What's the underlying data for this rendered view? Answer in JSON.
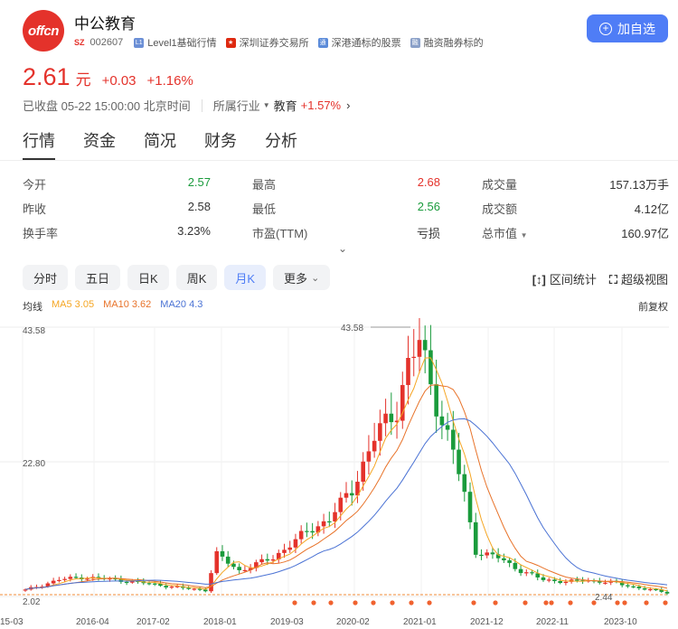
{
  "header": {
    "logo_text": "offcn",
    "stock_name": "中公教育",
    "market_tag": "SZ",
    "code": "002607",
    "badges": [
      {
        "icon": "level1-badge-icon",
        "label": "Level1基础行情"
      },
      {
        "icon": "china-flag-icon",
        "label": "深圳证券交易所"
      },
      {
        "icon": "shenzhen-hk-connect-icon",
        "label": "深港通标的股票"
      },
      {
        "icon": "margin-trading-icon",
        "label": "融资融券标的"
      }
    ],
    "add_button": "加自选"
  },
  "quote": {
    "price": "2.61",
    "unit": "元",
    "change": "+0.03",
    "change_pct": "+1.16%",
    "status": "已收盘 05-22 15:00:00 北京时间",
    "industry_label": "所属行业",
    "industry": "教育",
    "industry_change": "+1.57%"
  },
  "tabs": [
    "行情",
    "资金",
    "简况",
    "财务",
    "分析"
  ],
  "stats": [
    [
      {
        "label": "今开",
        "value": "2.57",
        "color": "green"
      },
      {
        "label": "最高",
        "value": "2.68",
        "color": "red"
      },
      {
        "label": "成交量",
        "value": "157.13万手",
        "color": "dark"
      }
    ],
    [
      {
        "label": "昨收",
        "value": "2.58",
        "color": "dark"
      },
      {
        "label": "最低",
        "value": "2.56",
        "color": "green"
      },
      {
        "label": "成交额",
        "value": "4.12亿",
        "color": "dark"
      }
    ],
    [
      {
        "label": "换手率",
        "value": "3.23%",
        "color": "dark"
      },
      {
        "label": "市盈(TTM)",
        "value": "亏损",
        "color": "dark"
      },
      {
        "label": "总市值",
        "value": "160.97亿",
        "color": "dark"
      }
    ]
  ],
  "kline_buttons": [
    "分时",
    "五日",
    "日K",
    "周K",
    "月K",
    "更多"
  ],
  "kline_active": "月K",
  "tools": {
    "range_stats": "区间统计",
    "super_view": "超级视图"
  },
  "ma": {
    "label": "均线",
    "ma5": "MA5 3.05",
    "ma10": "MA10 3.62",
    "ma20": "MA20 4.3"
  },
  "adjust": "前复权",
  "colors": {
    "up": "#e4322b",
    "down": "#1a9b3c",
    "ma5": "#f5a623",
    "ma10": "#e8732a",
    "ma20": "#4a72d4",
    "accent": "#4f7df6"
  },
  "chart_data": {
    "type": "candlestick",
    "y_labels": [
      "43.58",
      "22.80",
      "2.02"
    ],
    "x_labels": [
      "15-03",
      "2016-04",
      "2017-02",
      "2018-01",
      "2019-03",
      "2020-02",
      "2021-01",
      "2021-12",
      "2022-11",
      "2023-10"
    ],
    "ylim": [
      2.02,
      43.58
    ],
    "max_marker": "43.58",
    "min_marker": "2.44",
    "dates": [
      "15-03",
      "2016-04",
      "2017-02",
      "2018-01",
      "2019-03",
      "2020-02",
      "2021-01",
      "2021-12",
      "2022-11",
      "2023-10"
    ],
    "close": [
      4.5,
      5.0,
      4.2,
      3.6,
      6.5,
      15.0,
      34.0,
      5.5,
      3.4,
      2.6
    ],
    "ma20": [
      3.5,
      4.1,
      4.0,
      4.3,
      5.5,
      11.0,
      22.0,
      29.5,
      6.0,
      4.3
    ],
    "grid": true
  }
}
